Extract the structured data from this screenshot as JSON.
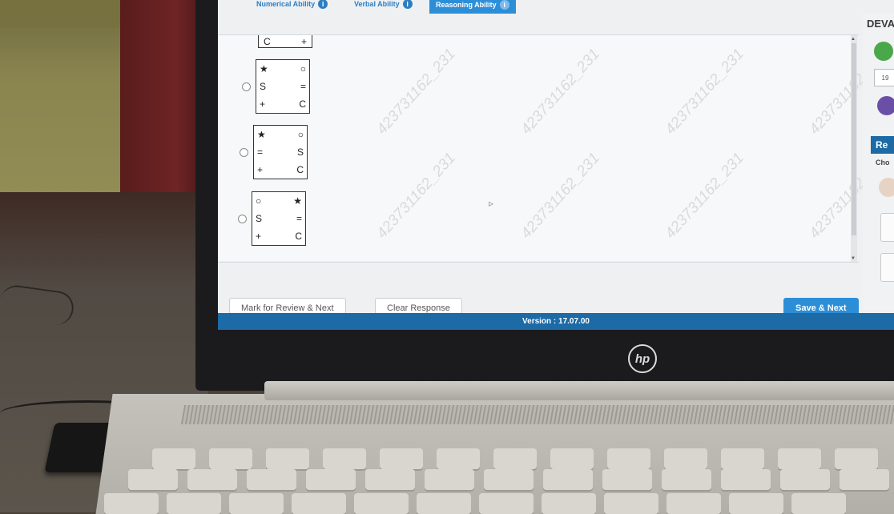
{
  "tabs": [
    {
      "label": "Numerical Ability",
      "info": "i",
      "active": false
    },
    {
      "label": "Verbal Ability",
      "info": "i",
      "active": false
    },
    {
      "label": "Reasoning Ability",
      "info": "i",
      "active": true
    }
  ],
  "watermark_text": "423731162_231",
  "options": [
    {
      "cells": [
        "★",
        "○",
        "S",
        "=",
        "+",
        "C"
      ]
    },
    {
      "cells": [
        "★",
        "○",
        "=",
        "S",
        "+",
        "C"
      ]
    },
    {
      "cells": [
        "○",
        "★",
        "S",
        "=",
        "+",
        "C"
      ]
    }
  ],
  "partial_option": {
    "left": "C",
    "right": "+"
  },
  "buttons": {
    "mark_review": "Mark for Review & Next",
    "clear": "Clear Response",
    "save_next": "Save & Next"
  },
  "footer": {
    "version": "Version : 17.07.00"
  },
  "sidepanel": {
    "candidate_name": "DEVA",
    "count": "19",
    "section": "Re",
    "choose": "Cho"
  },
  "laptop": {
    "brand": "hp"
  },
  "colors": {
    "accent": "#2d8ed8",
    "footer": "#1c6aa6"
  }
}
